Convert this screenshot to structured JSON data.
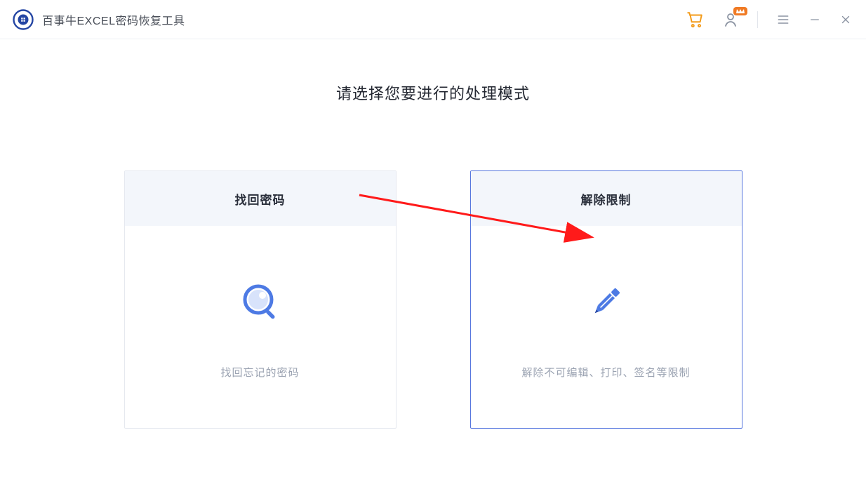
{
  "header": {
    "app_title": "百事牛EXCEL密码恢复工具"
  },
  "main": {
    "heading": "请选择您要进行的处理模式",
    "cards": [
      {
        "title": "找回密码",
        "desc": "找回忘记的密码",
        "icon": "search-icon",
        "selected": false
      },
      {
        "title": "解除限制",
        "desc": "解除不可编辑、打印、签名等限制",
        "icon": "pencil-icon",
        "selected": true
      }
    ]
  },
  "colors": {
    "accent_blue": "#5676de",
    "accent_orange": "#f39b1a"
  }
}
